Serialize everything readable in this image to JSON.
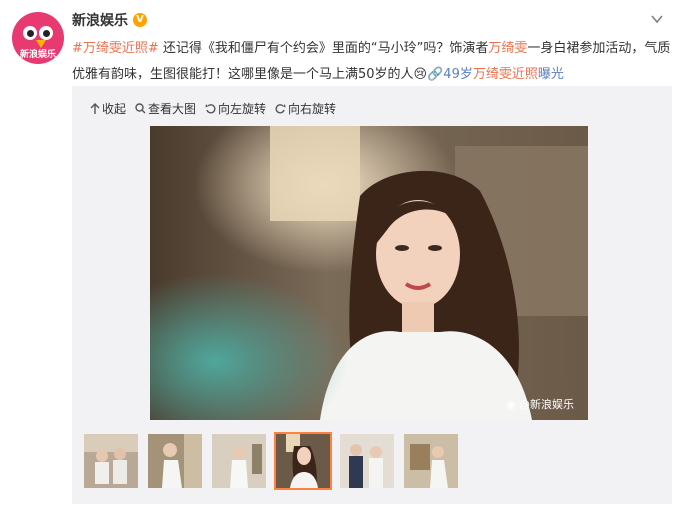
{
  "post": {
    "author": "新浪娱乐",
    "avatar_label": "新浪娱乐",
    "text": {
      "hashtag": "#万绮雯近照#",
      "part1": " 还记得《我和僵尸有个约会》里面的“马小玲”吗？饰演者",
      "mention": "万绮雯",
      "part2": "一身白裙参加活动，气质优雅有韵味，生图很能打！这哪里像是一个马上满50岁的人",
      "emoji": "😢",
      "link_prefix": "49岁",
      "link_highlight": "万绮雯近照",
      "link_suffix": "曝光"
    }
  },
  "toolbar": {
    "collapse": "收起",
    "view_large": "查看大图",
    "rotate_left": "向左旋转",
    "rotate_right": "向右旋转"
  },
  "photo": {
    "watermark": "@新浪娱乐"
  },
  "thumbnails": {
    "count": 6,
    "active_index": 3
  },
  "colors": {
    "highlight": "#eb7350",
    "link": "#eb7350",
    "active_thumb_border": "#ff8140",
    "media_bg": "#f2f2f5"
  }
}
